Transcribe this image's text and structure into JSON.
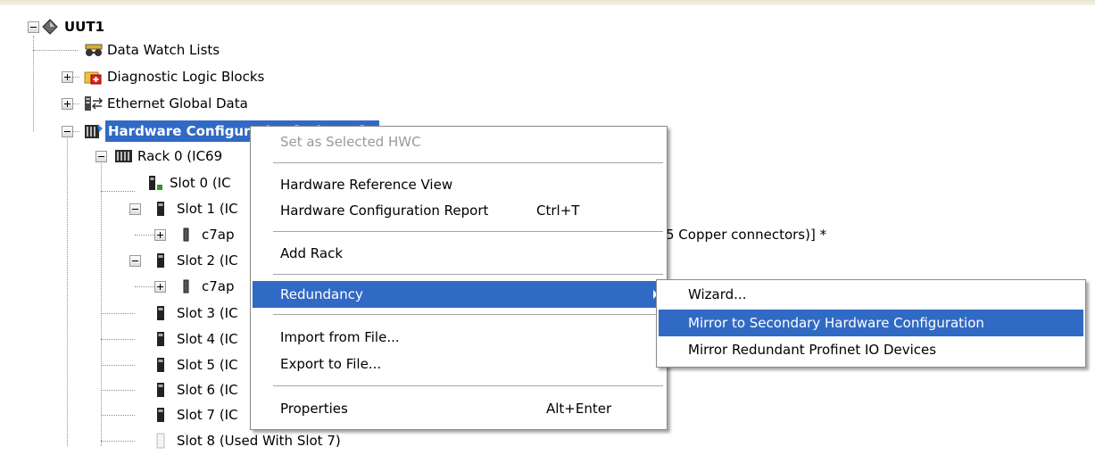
{
  "tree": {
    "root": "UUT1",
    "data_watch": "Data Watch Lists",
    "diagnostic": "Diagnostic Logic Blocks",
    "ethernet": "Ethernet Global Data",
    "hwc": "Hardware Configuration [Primary] *",
    "hwc_visible": "Hardware Conf",
    "rack0": "Rack 0 (IC69",
    "slots": [
      "Slot 0 (IC",
      "Slot 1 (IC",
      "c7ap",
      "Slot 2 (IC",
      "c7ap",
      "Slot 3 (IC",
      "Slot 4 (IC",
      "Slot 5 (IC",
      "Slot 6 (IC",
      "Slot 7 (IC",
      "Slot 8 (Used With Slot 7)"
    ],
    "trailing_text": "5 Copper connectors)] *"
  },
  "context_menu": {
    "set_selected": "Set as Selected HWC",
    "hw_ref_view": "Hardware Reference View",
    "hw_config_report": "Hardware Configuration Report",
    "hw_config_report_shortcut": "Ctrl+T",
    "add_rack": "Add Rack",
    "redundancy": "Redundancy",
    "import": "Import from File...",
    "export": "Export to File...",
    "properties": "Properties",
    "properties_shortcut": "Alt+Enter"
  },
  "submenu": {
    "wizard": "Wizard...",
    "mirror_secondary": "Mirror to Secondary Hardware Configuration",
    "mirror_profinet": "Mirror Redundant Profinet IO Devices"
  },
  "colors": {
    "highlight": "#316ac5",
    "highlight_text": "#ffffff",
    "disabled_text": "#9a9a9a"
  }
}
